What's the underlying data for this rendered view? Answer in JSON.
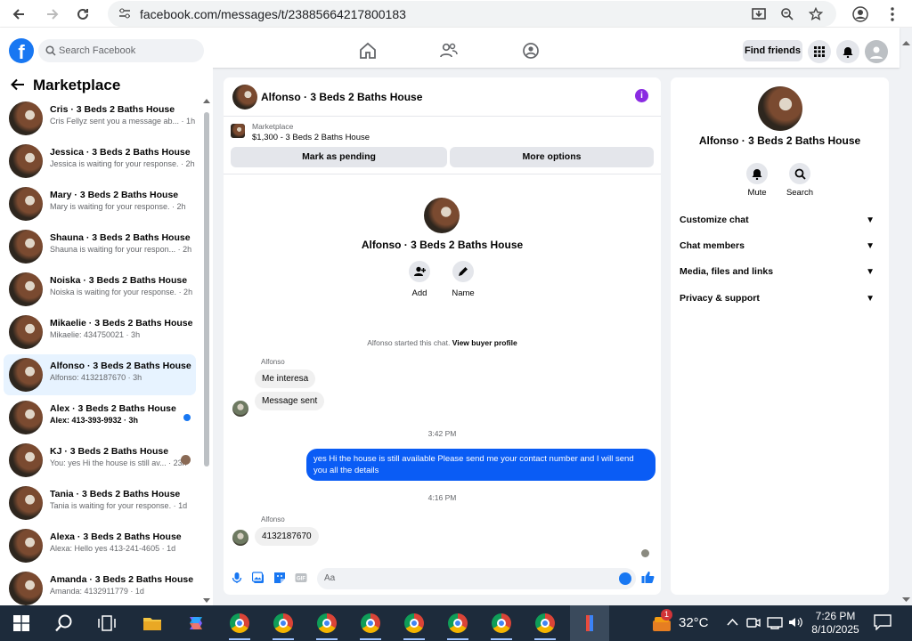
{
  "browser": {
    "url": "facebook.com/messages/t/23885664217800183"
  },
  "facebook": {
    "search_placeholder": "Search Facebook",
    "find_friends": "Find friends"
  },
  "sidebar": {
    "title": "Marketplace",
    "conversations": [
      {
        "title": "Cris · 3 Beds 2 Baths House",
        "snippet": "Cris Fellyz sent you a message ab... · 1h"
      },
      {
        "title": "Jessica · 3 Beds 2 Baths House",
        "snippet": "Jessica is waiting for your response. · 2h"
      },
      {
        "title": "Mary · 3 Beds 2 Baths House",
        "snippet": "Mary is waiting for your response. · 2h"
      },
      {
        "title": "Shauna · 3 Beds 2 Baths House",
        "snippet": "Shauna is waiting for your respon... · 2h"
      },
      {
        "title": "Noiska · 3 Beds 2 Baths House",
        "snippet": "Noiska is waiting for your response. · 2h"
      },
      {
        "title": "Mikaelie · 3 Beds 2 Baths House",
        "snippet": "Mikaelie: 434750021 · 3h"
      },
      {
        "title": "Alfonso · 3 Beds 2 Baths House",
        "snippet": "Alfonso: 4132187670 · 3h"
      },
      {
        "title": "Alex · 3 Beds 2 Baths House",
        "snippet": "Alex: 413-393-9932 · 3h"
      },
      {
        "title": "KJ · 3 Beds 2 Baths House",
        "snippet": "You: yes Hi the house is still av... · 23h"
      },
      {
        "title": "Tania · 3 Beds 2 Baths House",
        "snippet": "Tania is waiting for your response. · 1d"
      },
      {
        "title": "Alexa · 3 Beds 2 Baths House",
        "snippet": "Alexa: Hello yes 413-241-4605 · 1d"
      },
      {
        "title": "Amanda · 3 Beds 2 Baths House",
        "snippet": "Amanda: 4132911779 · 1d"
      }
    ]
  },
  "chat": {
    "title": "Alfonso · 3 Beds 2 Baths House",
    "listing_label": "Marketplace",
    "listing_price": "$1,300 - 3 Beds 2 Baths House",
    "mark_pending": "Mark as pending",
    "more_options": "More options",
    "intro_name": "Alfonso · 3 Beds 2 Baths House",
    "add_label": "Add",
    "name_label": "Name",
    "started_text": "Alfonso started this chat.",
    "view_buyer": "View buyer profile",
    "sender1": "Alfonso",
    "msg1": "Me interesa",
    "msg2": "Message sent",
    "time1": "3:42 PM",
    "my_msg": "yes Hi the house is still available Please send me your contact number and I will send you all the details",
    "time2": "4:16 PM",
    "sender2": "Alfonso",
    "msg3": "4132187670",
    "compose_placeholder": "Aa"
  },
  "details": {
    "name": "Alfonso · 3 Beds 2 Baths House",
    "mute": "Mute",
    "search": "Search",
    "sections": [
      "Customize chat",
      "Chat members",
      "Media, files and links",
      "Privacy & support"
    ]
  },
  "taskbar": {
    "temperature": "32°C",
    "weather_badge": "1",
    "time": "7:26 PM",
    "date": "8/10/2025"
  },
  "colors": {
    "accent": "#1877f2",
    "my_bubble": "#0a5cf5",
    "info": "#8a2be2"
  }
}
